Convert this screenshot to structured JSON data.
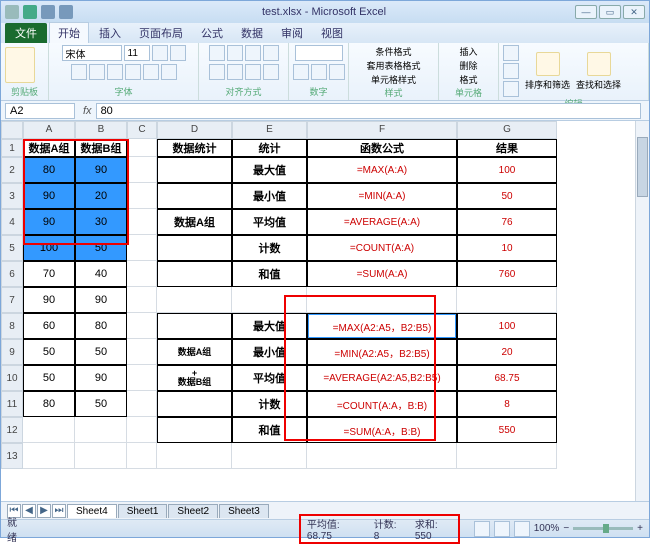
{
  "window": {
    "title": "test.xlsx - Microsoft Excel"
  },
  "tabs": {
    "file": "文件",
    "items": [
      "开始",
      "插入",
      "页面布局",
      "公式",
      "数据",
      "审阅",
      "视图"
    ],
    "active": 0
  },
  "ribbon": {
    "clipboard": "剪贴板",
    "font": {
      "label": "字体",
      "name": "宋体",
      "size": "11"
    },
    "align": "对齐方式",
    "number": "数字",
    "styles": {
      "label": "样式",
      "cond": "条件格式",
      "table": "套用表格格式",
      "cell": "单元格样式"
    },
    "cells": {
      "label": "单元格",
      "insert": "插入",
      "delete": "删除",
      "format": "格式"
    },
    "editing": {
      "label": "编辑",
      "sort": "排序和筛选",
      "find": "查找和选择"
    }
  },
  "address": {
    "cell": "A2",
    "formula": "80"
  },
  "cols": [
    "A",
    "B",
    "C",
    "D",
    "E",
    "F",
    "G"
  ],
  "rownums": [
    "1",
    "2",
    "3",
    "4",
    "5",
    "6",
    "7",
    "8",
    "9",
    "10",
    "11",
    "12",
    "13"
  ],
  "grid": {
    "r1": {
      "A": "数据A组",
      "B": "数据B组",
      "D": "数据统计",
      "E": "统计",
      "F": "函数公式",
      "G": "结果"
    },
    "r2": {
      "A": "80",
      "B": "90",
      "E": "最大值",
      "F": "=MAX(A:A)",
      "G": "100"
    },
    "r3": {
      "A": "90",
      "B": "20",
      "E": "最小值",
      "F": "=MIN(A:A)",
      "G": "50"
    },
    "r4": {
      "A": "90",
      "B": "30",
      "D": "数据A组",
      "E": "平均值",
      "F": "=AVERAGE(A:A)",
      "G": "76"
    },
    "r5": {
      "A": "100",
      "B": "50",
      "E": "计数",
      "F": "=COUNT(A:A)",
      "G": "10"
    },
    "r6": {
      "A": "70",
      "B": "40",
      "E": "和值",
      "F": "=SUM(A:A)",
      "G": "760"
    },
    "r7": {
      "A": "90",
      "B": "90"
    },
    "r8": {
      "A": "60",
      "B": "80",
      "E": "最大值",
      "F": "=MAX(A2:A5，B2:B5)",
      "G": "100"
    },
    "r9": {
      "A": "50",
      "B": "50",
      "D1": "数据A组",
      "D2": "+",
      "D3": "数据B组",
      "E": "最小值",
      "F": "=MIN(A2:A5，B2:B5)",
      "G": "20"
    },
    "r10": {
      "A": "50",
      "B": "90",
      "E": "平均值",
      "F": "=AVERAGE(A2:A5,B2:B5)",
      "G": "68.75"
    },
    "r11": {
      "A": "80",
      "B": "50",
      "E": "计数",
      "F": "=COUNT(A:A，B:B)",
      "G": "8"
    },
    "r12": {
      "E": "和值",
      "F": "=SUM(A:A，B:B)",
      "G": "550"
    }
  },
  "sheets": {
    "nav": [
      "⏮",
      "◀",
      "▶",
      "⏭"
    ],
    "items": [
      "Sheet4",
      "Sheet1",
      "Sheet2",
      "Sheet3"
    ],
    "active": 0
  },
  "status": {
    "ready": "就绪",
    "avg_l": "平均值:",
    "avg_v": "68.75",
    "cnt_l": "计数:",
    "cnt_v": "8",
    "sum_l": "求和:",
    "sum_v": "550",
    "zoom": "100%"
  }
}
